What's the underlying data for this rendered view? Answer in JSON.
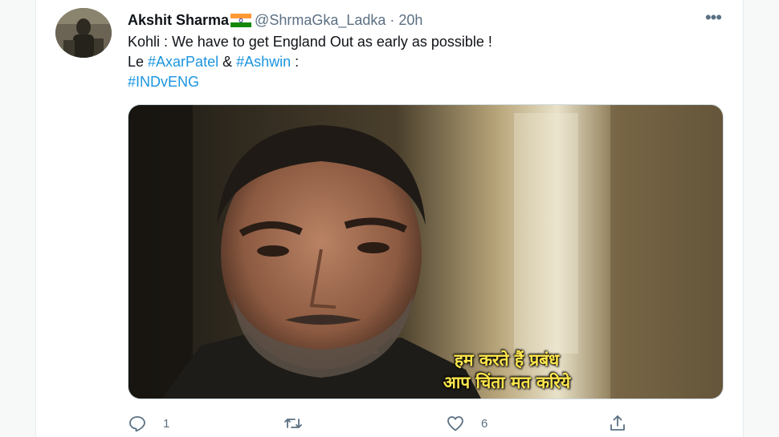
{
  "tweet": {
    "author_name": "Akshit Sharma",
    "author_flag_icon": "india-flag-icon",
    "handle": "@ShrmaGka_Ladka",
    "separator": "·",
    "time": "20h",
    "more_label": "•••",
    "lines": {
      "line1": "Kohli : We have to get England Out as early as possible !",
      "line2_prefix": "Le ",
      "line2_tag1": "#AxarPatel",
      "line2_amp": " & ",
      "line2_tag2": "#Ashwin",
      "line2_suffix": " :",
      "line3_tag": "#INDvENG"
    },
    "media": {
      "subtitle_line1": "हम करते हैं प्रबंध",
      "subtitle_line2": "आप चिंता मत करिये"
    },
    "actions": {
      "reply_count": "1",
      "retweet_count": "",
      "like_count": "6"
    },
    "colors": {
      "hashtag": "#1b95e0",
      "secondary": "#5b7083",
      "subtitle": "#ffe64d"
    }
  }
}
